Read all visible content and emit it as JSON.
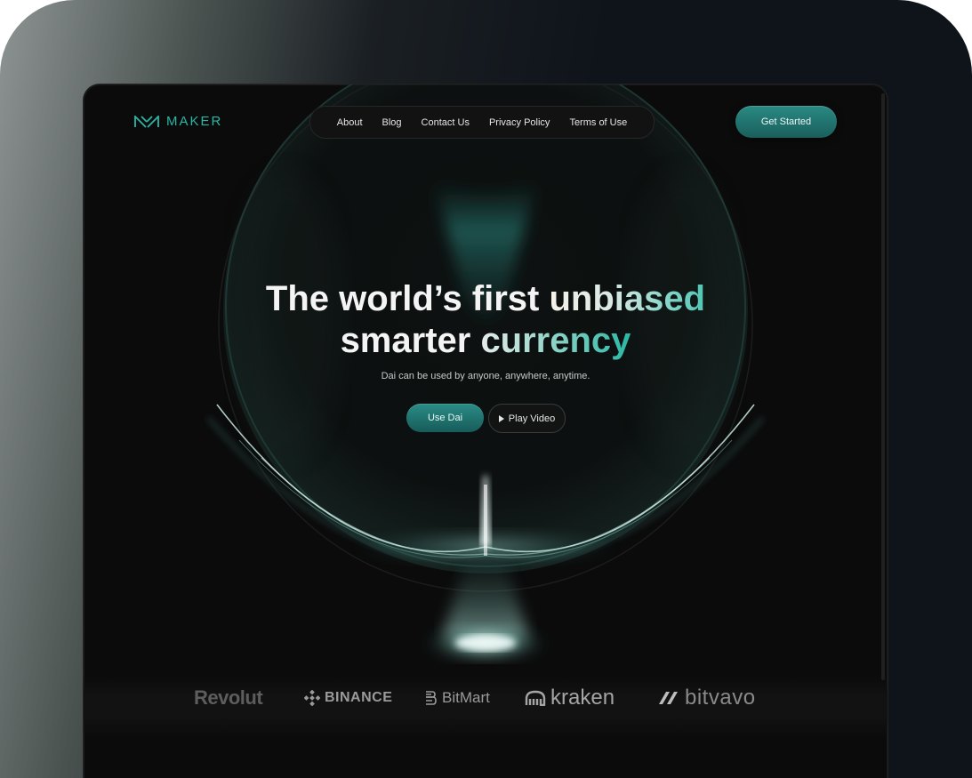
{
  "brand": {
    "name": "MAKER",
    "accent": "#29b7a5"
  },
  "nav": {
    "items": [
      {
        "label": "About"
      },
      {
        "label": "Blog"
      },
      {
        "label": "Contact Us"
      },
      {
        "label": "Privacy Policy"
      },
      {
        "label": "Terms of Use"
      }
    ],
    "cta_label": "Get Started"
  },
  "hero": {
    "title_line1_plain": "The world’s first ",
    "title_line1_highlight": "unbiased",
    "title_line2_plain": "smarter ",
    "title_line2_highlight": "currency",
    "subtitle": "Dai can be used by anyone, anywhere, anytime.",
    "primary_button": "Use Dai",
    "secondary_button": "Play Video",
    "secondary_icon": "play-icon"
  },
  "partners": [
    {
      "name": "Revolut",
      "icon": null
    },
    {
      "name": "BINANCE",
      "icon": "binance-icon"
    },
    {
      "name": "BitMart",
      "icon": "bitmart-icon"
    },
    {
      "name": "kraken",
      "icon": "kraken-icon"
    },
    {
      "name": "bitvavo",
      "icon": "bitvavo-icon"
    }
  ],
  "colors": {
    "background": "#0b0b0b",
    "device_frame": "#0f141b",
    "button_teal": "#1f7673"
  }
}
